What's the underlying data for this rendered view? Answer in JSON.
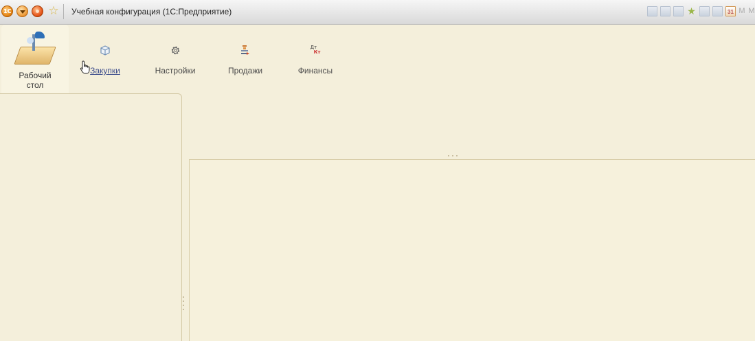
{
  "window": {
    "title": "Учебная конфигурация (1С:Предприятие)",
    "logo_text": "1С",
    "right_toolbar": [
      "save-icon",
      "print-icon",
      "preview-icon",
      "favorites-icon",
      "history-icon",
      "calculator-icon",
      "calendar-icon",
      "M",
      "M"
    ],
    "calendar_day": "31",
    "letter_m1": "M",
    "letter_m2": "M"
  },
  "sections": {
    "items": [
      {
        "label_line1": "Рабочий",
        "label_line2": "стол",
        "icon": "desktop-icon",
        "active": true
      },
      {
        "label": "Закупки",
        "icon": "box-icon",
        "hovered": true
      },
      {
        "label": "Настройки",
        "icon": "gear-icon"
      },
      {
        "label": "Продажи",
        "icon": "sales-icon"
      },
      {
        "label": "Финансы",
        "icon": "dt-kt-icon",
        "icon_text_dt": "Дт",
        "icon_text_kt": "Кт"
      }
    ]
  },
  "colors": {
    "background": "#f4efdb",
    "active_section": "#f8f4e2",
    "link": "#3a4a8a"
  }
}
